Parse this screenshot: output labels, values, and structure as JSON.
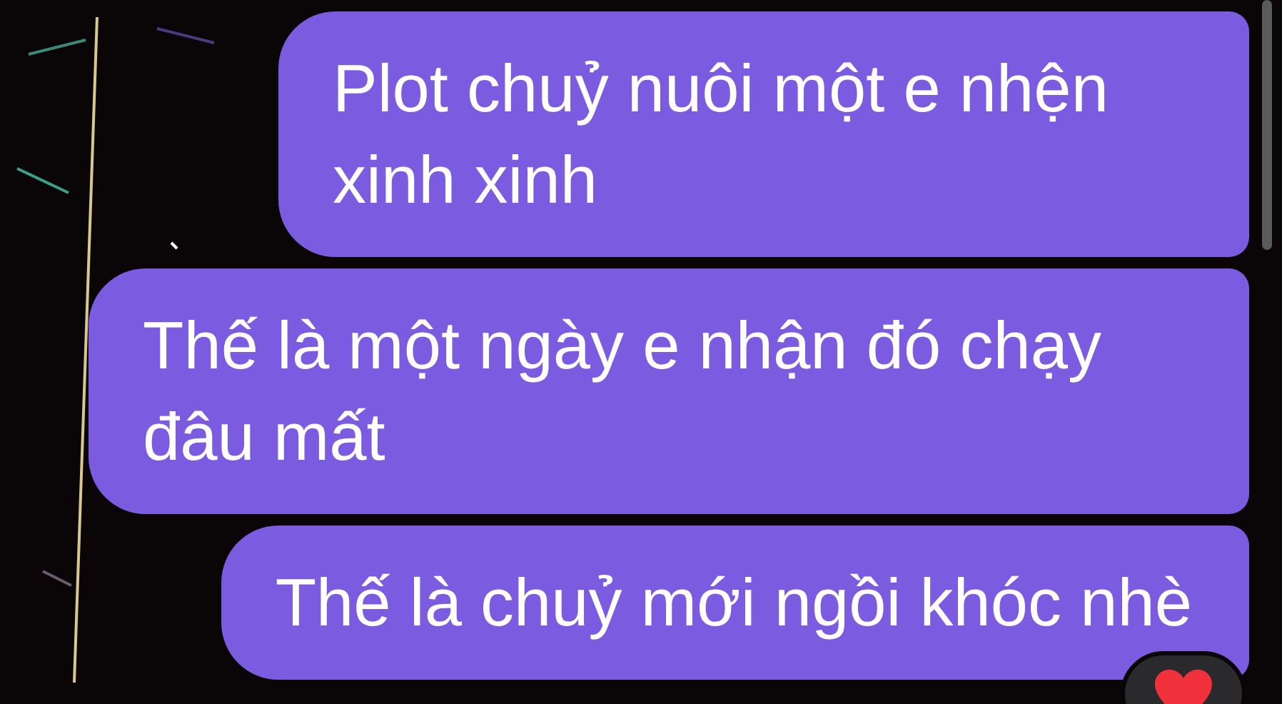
{
  "messages": [
    {
      "text": "Plot chuỷ nuôi một e nhện xinh xinh",
      "heart_reaction": false
    },
    {
      "text": "Thế là một ngày e nhận đó chạy đâu mất",
      "heart_reaction": false
    },
    {
      "text": "Thế là chuỷ mới ngồi khóc nhè",
      "heart_reaction": true
    }
  ]
}
